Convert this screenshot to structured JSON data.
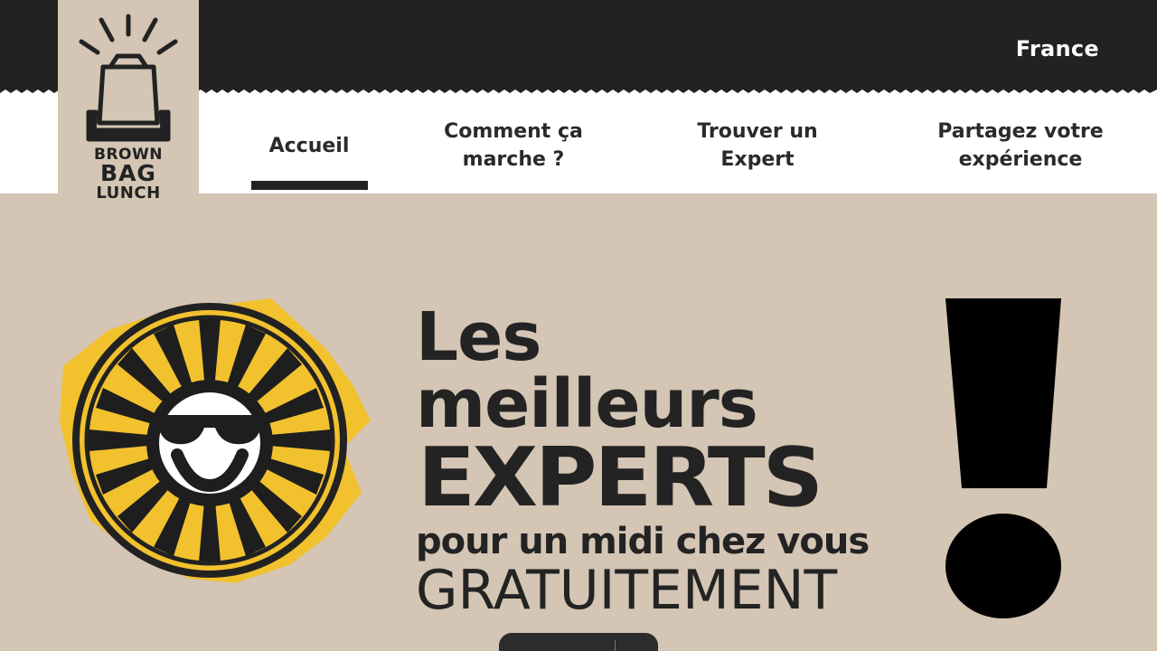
{
  "header": {
    "country": "France"
  },
  "logo": {
    "line1": "BROWN",
    "line2": "BAG",
    "line3": "LUNCH"
  },
  "nav": {
    "items": [
      {
        "label_line1": "Accueil",
        "label_line2": ""
      },
      {
        "label_line1": "Comment ça",
        "label_line2": "marche ?"
      },
      {
        "label_line1": "Trouver un",
        "label_line2": "Expert"
      },
      {
        "label_line1": "Partagez votre",
        "label_line2": "expérience"
      }
    ],
    "active_index": 0
  },
  "hero": {
    "line1": "Les",
    "line2": "meilleurs",
    "line3": "EXPERTS",
    "line4": "pour un midi chez vous",
    "line5": "GRATUITEMENT"
  },
  "colors": {
    "background": "#d4c5b4",
    "dark": "#222222",
    "accent_yellow": "#f2c12e",
    "white": "#ffffff"
  },
  "icons": {
    "logo_icon": "lunch-bag-icon",
    "emblem_icon": "smiley-sunglasses-icon",
    "exclamation": "exclamation-mark-icon"
  }
}
